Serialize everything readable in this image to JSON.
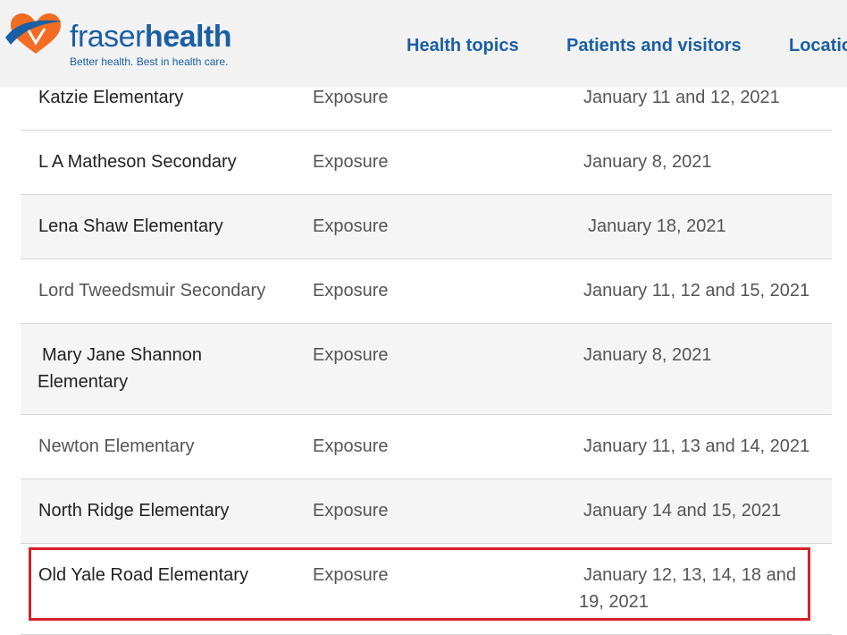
{
  "header": {
    "logo": {
      "name_light": "fraser",
      "name_bold": "health",
      "tagline": "Better health. Best in health care."
    },
    "nav": [
      "Health topics",
      "Patients and visitors",
      "Locatio"
    ]
  },
  "table": {
    "rows": [
      {
        "school": "Katzie Elementary",
        "type": "Exposure",
        "dates": "January 11 and 12, 2021"
      },
      {
        "school": "L A Matheson Secondary",
        "type": "Exposure",
        "dates": "January 8, 2021"
      },
      {
        "school": "Lena Shaw Elementary",
        "type": "Exposure",
        "dates": "January 18, 2021"
      },
      {
        "school": "Lord Tweedsmuir Secondary",
        "type": "Exposure",
        "dates": "January 11, 12 and 15, 2021"
      },
      {
        "school": "Mary Jane Shannon Elementary",
        "type": "Exposure",
        "dates": "January 8, 2021"
      },
      {
        "school": "Newton Elementary",
        "type": "Exposure",
        "dates": "January 11, 13 and 14, 2021"
      },
      {
        "school": "North Ridge Elementary",
        "type": "Exposure",
        "dates": "January 14 and 15, 2021"
      },
      {
        "school": "Old Yale Road Elementary",
        "type": "Exposure",
        "dates": "January 12, 13, 14, 18 and 19, 2021"
      }
    ]
  },
  "colors": {
    "brand_blue": "#1b5fa5",
    "logo_orange": "#f26c21",
    "highlight_red": "#d4222a"
  }
}
